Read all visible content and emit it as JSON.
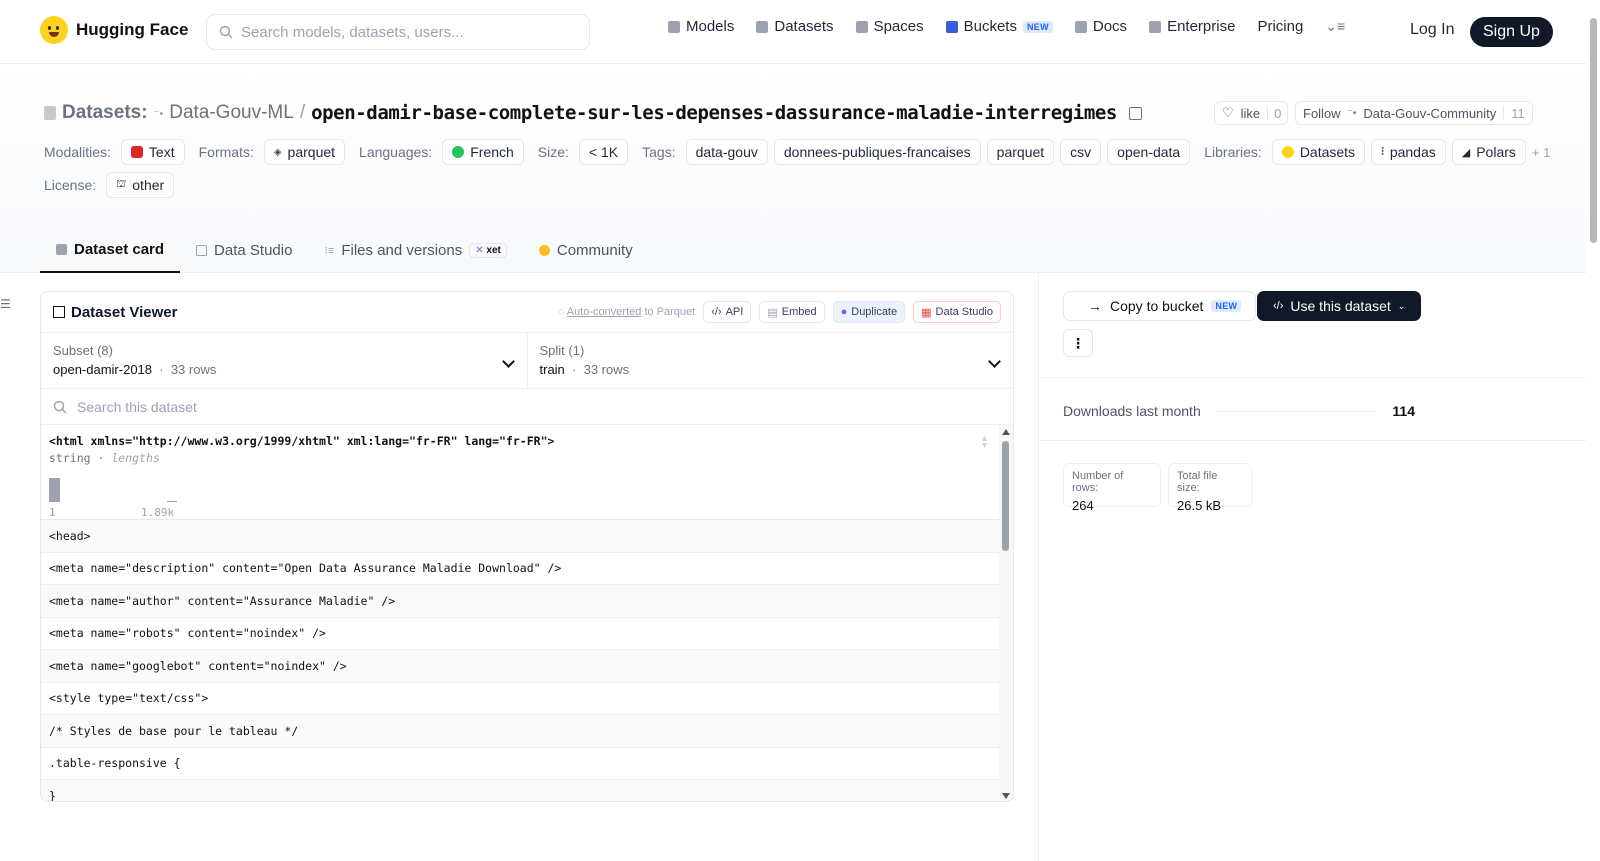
{
  "nav": {
    "logo": "Hugging Face",
    "search_placeholder": "Search models, datasets, users...",
    "links": [
      "Models",
      "Datasets",
      "Spaces",
      "Buckets",
      "Docs",
      "Enterprise",
      "Pricing"
    ],
    "new_badge": "NEW",
    "login": "Log In",
    "signup": "Sign Up"
  },
  "header": {
    "section_label": "Datasets:",
    "org": "Data-Gouv-ML",
    "separator": "/",
    "dataset_name": "open-damir-base-complete-sur-les-depenses-dassurance-maladie-interregimes",
    "like_label": "like",
    "like_count": "0",
    "follow_label": "Follow",
    "follow_org": "Data-Gouv-Community",
    "follow_count": "11",
    "meta": {
      "modalities_label": "Modalities:",
      "modalities": "Text",
      "formats_label": "Formats:",
      "formats": "parquet",
      "languages_label": "Languages:",
      "languages": "French",
      "size_label": "Size:",
      "size": "< 1K",
      "tags_label": "Tags:",
      "tags": [
        "data-gouv",
        "donnees-publiques-francaises",
        "parquet",
        "csv",
        "open-data"
      ],
      "libraries_label": "Libraries:",
      "libraries": [
        "Datasets",
        "pandas",
        "Polars"
      ],
      "libraries_more": "+ 1",
      "license_label": "License:",
      "license": "other"
    },
    "tabs": [
      "Dataset card",
      "Data Studio",
      "Files and versions",
      "Community"
    ],
    "xet_badge": "xet"
  },
  "viewer": {
    "title": "Dataset Viewer",
    "auto_converted": "Auto-converted",
    "auto_converted_suffix": "to Parquet",
    "actions": [
      "API",
      "Embed",
      "Duplicate",
      "Data Studio"
    ],
    "subset_label": "Subset (8)",
    "subset_value": "open-damir-2018",
    "subset_rows": "33 rows",
    "split_label": "Split (1)",
    "split_value": "train",
    "split_rows": "33 rows",
    "search_placeholder": "Search this dataset",
    "column_name": "<html xmlns=\"http://www.w3.org/1999/xhtml\" xml:lang=\"fr-FR\" lang=\"fr-FR\">",
    "column_type": "string",
    "column_type_suffix": "lengths",
    "hist_min": "1",
    "hist_max": "1.89k",
    "rows": [
      "<head>",
      "<meta name=\"description\" content=\"Open Data Assurance Maladie Download\" />",
      "<meta name=\"author\" content=\"Assurance Maladie\" />",
      "<meta name=\"robots\" content=\"noindex\" />",
      "<meta name=\"googlebot\" content=\"noindex\" />",
      "<style type=\"text/css\">",
      "/* Styles de base pour le tableau */",
      ".table-responsive {",
      "}"
    ]
  },
  "side": {
    "copy_bucket": "Copy to bucket",
    "new_badge": "NEW",
    "use_dataset": "Use this dataset",
    "downloads_label": "Downloads last month",
    "downloads_value": "114",
    "rows_label": "Number of rows:",
    "rows_value": "264",
    "filesize_label": "Total file size:",
    "filesize_value": "26.5 kB"
  }
}
